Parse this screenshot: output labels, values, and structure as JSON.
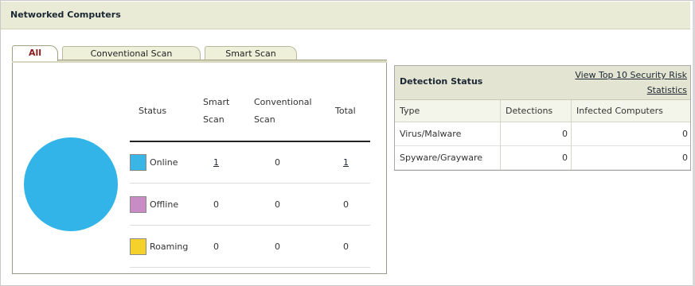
{
  "panel": {
    "title": "Networked Computers"
  },
  "tabs": [
    {
      "label": "All",
      "active": true
    },
    {
      "label": "Conventional Scan",
      "active": false
    },
    {
      "label": "Smart Scan",
      "active": false
    }
  ],
  "status_table": {
    "headers": {
      "status": "Status",
      "smart": [
        "Smart",
        "Scan"
      ],
      "conventional": [
        "Conventional",
        "Scan"
      ],
      "total": "Total"
    },
    "rows": [
      {
        "status": "Online",
        "color": "#39b5e6",
        "smart": "1",
        "conventional": "0",
        "total": "1"
      },
      {
        "status": "Offline",
        "color": "#c98bc4",
        "smart": "0",
        "conventional": "0",
        "total": "0"
      },
      {
        "status": "Roaming",
        "color": "#f5d22b",
        "smart": "0",
        "conventional": "0",
        "total": "0"
      }
    ],
    "pie_color": "#33b4e8"
  },
  "detection": {
    "title": "Detection Status",
    "link_lines": [
      "View Top 10 Security Risk",
      "Statistics"
    ],
    "columns": [
      "Type",
      "Detections",
      "Infected Computers"
    ],
    "rows": [
      {
        "type": "Virus/Malware",
        "detections": "0",
        "infected": "0"
      },
      {
        "type": "Spyware/Grayware",
        "detections": "0",
        "infected": "0"
      }
    ]
  }
}
